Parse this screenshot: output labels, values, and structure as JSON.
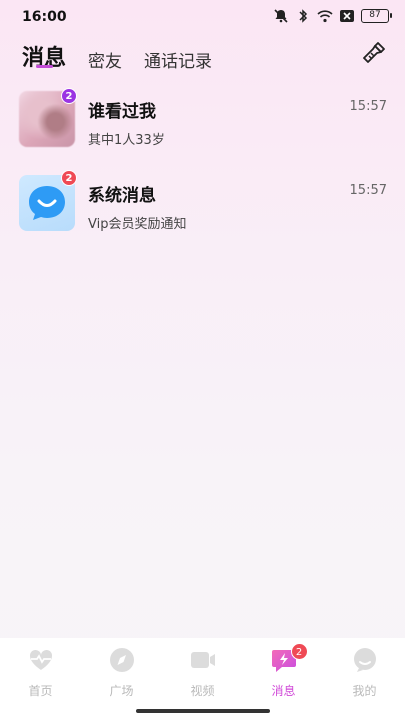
{
  "status_bar": {
    "time": "16:00",
    "battery": "87"
  },
  "tabs": [
    {
      "label": "消息",
      "active": true
    },
    {
      "label": "密友",
      "active": false
    },
    {
      "label": "通话记录",
      "active": false
    }
  ],
  "messages": [
    {
      "title": "谁看过我",
      "subtitle": "其中1人33岁",
      "time": "15:57",
      "badge": "2",
      "avatar": "blurred-photo"
    },
    {
      "title": "系统消息",
      "subtitle": "Vip会员奖励通知",
      "time": "15:57",
      "badge": "2",
      "avatar": "system-chat-icon"
    }
  ],
  "bottom_nav": [
    {
      "label": "首页",
      "icon": "heart-pulse-icon",
      "active": false
    },
    {
      "label": "广场",
      "icon": "compass-icon",
      "active": false
    },
    {
      "label": "视频",
      "icon": "video-camera-icon",
      "active": false
    },
    {
      "label": "消息",
      "icon": "message-bolt-icon",
      "active": true,
      "badge": "2"
    },
    {
      "label": "我的",
      "icon": "profile-chat-icon",
      "active": false
    }
  ],
  "colors": {
    "accent": "#d14bd8",
    "badge_red": "#ef4a55",
    "badge_purple": "#9b34e3"
  }
}
